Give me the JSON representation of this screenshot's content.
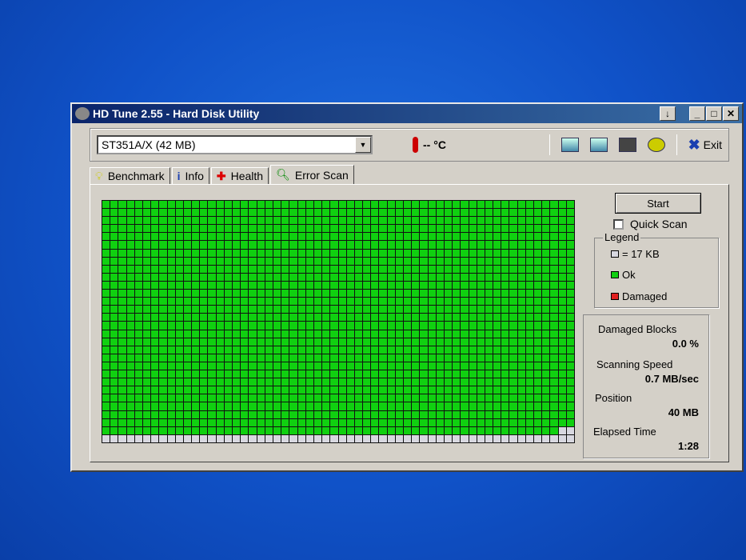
{
  "window": {
    "title": "HD Tune 2.55 - Hard Disk Utility"
  },
  "toolbar": {
    "drive": "ST351A/X (42 MB)",
    "temperature": "-- °C",
    "exit_label": "Exit"
  },
  "tabs": [
    {
      "label": "Benchmark"
    },
    {
      "label": "Info"
    },
    {
      "label": "Health"
    },
    {
      "label": "Error Scan"
    }
  ],
  "scan": {
    "start_label": "Start",
    "quick_scan_label": "Quick Scan",
    "quick_scan_checked": false,
    "columns": 58,
    "rows": 30,
    "blocks_scanned": 1680
  },
  "legend": {
    "title": "Legend",
    "block_size": "= 17 KB",
    "ok": "Ok",
    "damaged": "Damaged",
    "colors": {
      "unscanned": "#d8d8e0",
      "ok": "#10d010",
      "damaged": "#e02020"
    }
  },
  "stats": {
    "damaged_blocks_label": "Damaged Blocks",
    "damaged_blocks": "0.0 %",
    "speed_label": "Scanning Speed",
    "speed": "0.7 MB/sec",
    "position_label": "Position",
    "position": "40 MB",
    "elapsed_label": "Elapsed Time",
    "elapsed": "1:28"
  }
}
